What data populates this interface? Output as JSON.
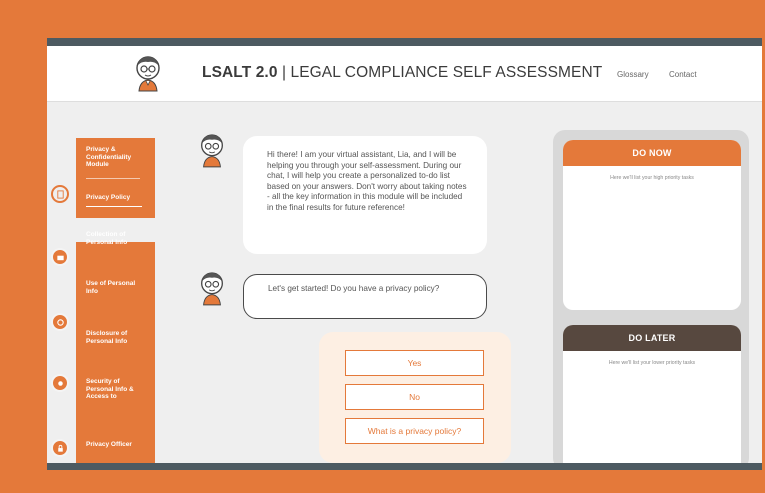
{
  "colors": {
    "accent": "#e4793a",
    "dark": "#4d5a61",
    "later": "#57483f"
  },
  "header": {
    "title_bold": "LSALT 2.0",
    "title_rest": " | LEGAL COMPLIANCE SELF ASSESSMENT",
    "nav": {
      "glossary": "Glossary",
      "contact": "Contact"
    },
    "logo_icon": "assistant-avatar-icon"
  },
  "sidebar": {
    "items": [
      {
        "label": "Privacy & Confidentiality Module"
      },
      {
        "label": "Privacy Policy",
        "active": true
      },
      {
        "label": "Collection of Personal Info"
      },
      {
        "label": "Use of Personal Info"
      },
      {
        "label": "Disclosure of Personal Info"
      },
      {
        "label": "Security of Personal Info & Access to"
      },
      {
        "label": "Privacy Officer"
      }
    ]
  },
  "chat": {
    "intro": "Hi there! I am your virtual assistant, Lia, and I will be helping you through your self-assessment. During our chat, I will help you create a personalized to-do list based on your answers. Don't worry about taking notes - all the key information in this module will be included in the final results for future reference!",
    "question": "Let's get started! Do you have a privacy policy?",
    "answers": [
      "Yes",
      "No",
      "What is a privacy policy?"
    ]
  },
  "panels": {
    "do_now": {
      "title": "DO NOW",
      "subtitle": "Here we'll list your high priority tasks"
    },
    "do_later": {
      "title": "DO LATER",
      "subtitle": "Here we'll list your lower priority tasks"
    }
  }
}
